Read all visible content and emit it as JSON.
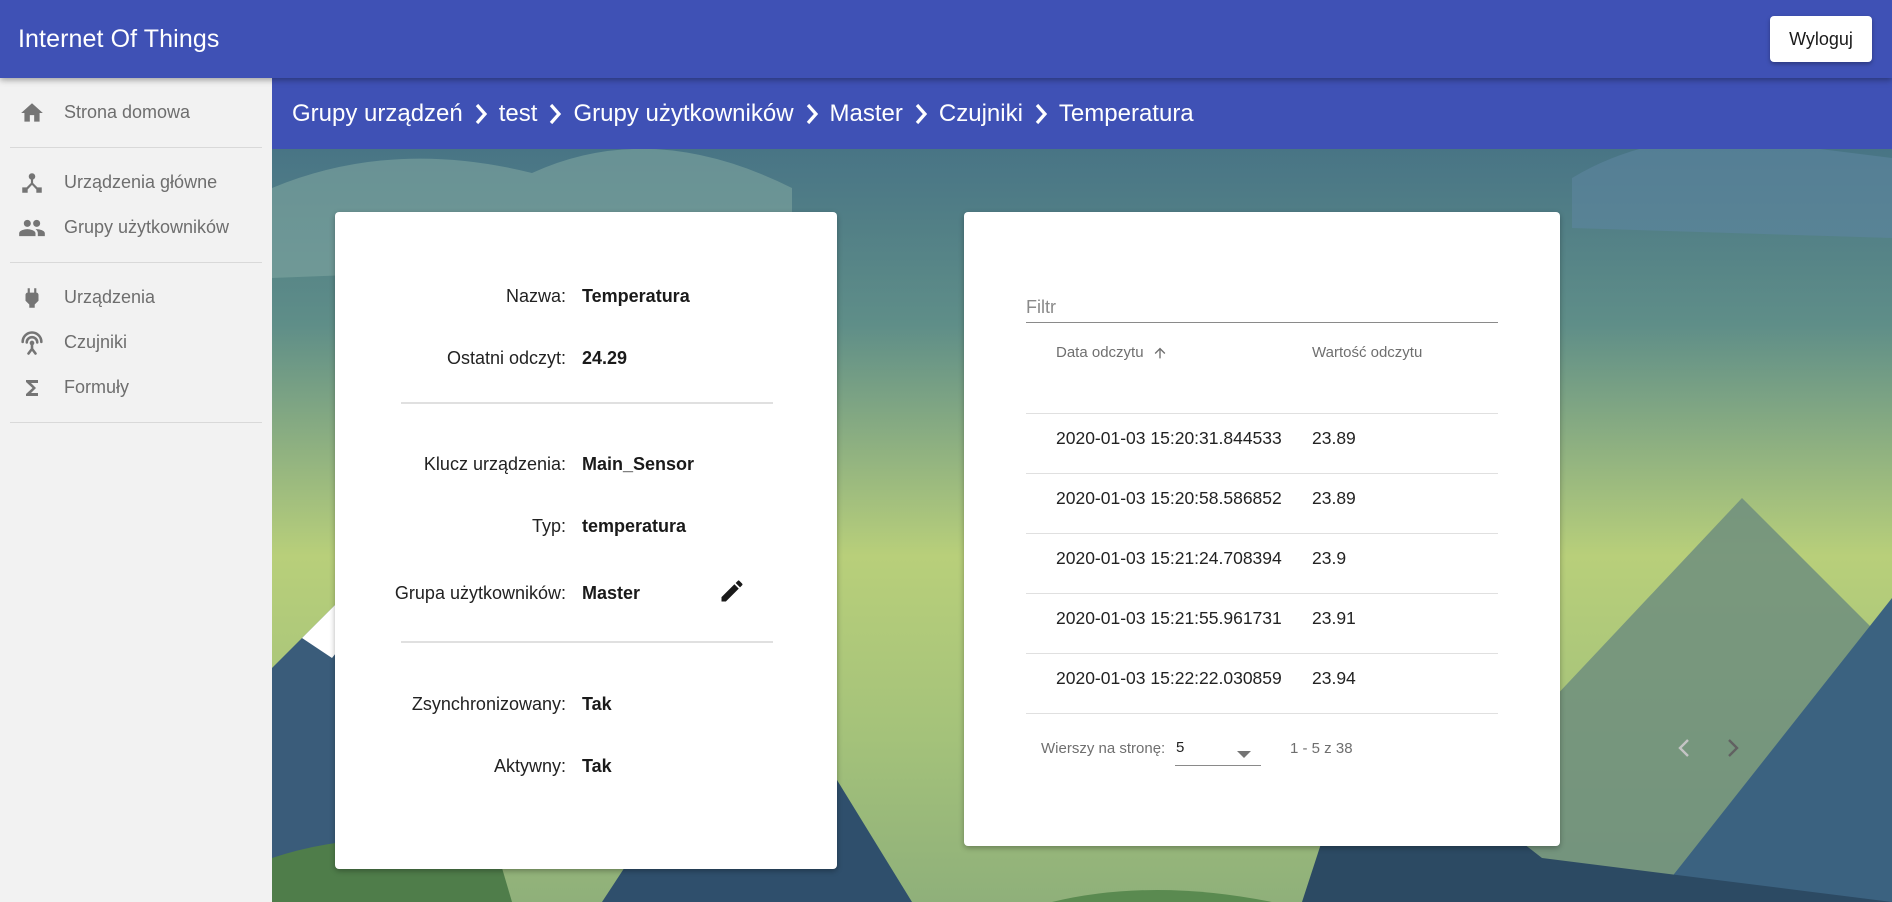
{
  "app": {
    "title": "Internet Of Things",
    "logout_label": "Wyloguj",
    "primary_color": "#3f51b5"
  },
  "sidebar": {
    "groups": [
      [
        {
          "label": "Strona domowa",
          "icon": "home-icon"
        }
      ],
      [
        {
          "label": "Urządzenia główne",
          "icon": "device-hub-icon"
        },
        {
          "label": "Grupy użytkowników",
          "icon": "people-icon"
        }
      ],
      [
        {
          "label": "Urządzenia",
          "icon": "power-plug-icon"
        },
        {
          "label": "Czujniki",
          "icon": "antenna-icon"
        },
        {
          "label": "Formuły",
          "icon": "sigma-icon"
        }
      ]
    ]
  },
  "breadcrumb": [
    "Grupy urządzeń",
    "test",
    "Grupy użytkowników",
    "Master",
    "Czujniki",
    "Temperatura"
  ],
  "details": {
    "name_label": "Nazwa:",
    "name_value": "Temperatura",
    "last_reading_label": "Ostatni odczyt:",
    "last_reading_value": "24.29",
    "device_key_label": "Klucz urządzenia:",
    "device_key_value": "Main_Sensor",
    "type_label": "Typ:",
    "type_value": "temperatura",
    "user_group_label": "Grupa użytkowników:",
    "user_group_value": "Master",
    "synced_label": "Zsynchronizowany:",
    "synced_value": "Tak",
    "active_label": "Aktywny:",
    "active_value": "Tak"
  },
  "readings": {
    "filter_placeholder": "Filtr",
    "filter_value": "",
    "columns": {
      "date": "Data odczytu",
      "value": "Wartość odczytu"
    },
    "sort": {
      "column": "date",
      "direction": "asc"
    },
    "rows": [
      {
        "date": "2020-01-03 15:20:31.844533",
        "value": "23.89"
      },
      {
        "date": "2020-01-03 15:20:58.586852",
        "value": "23.89"
      },
      {
        "date": "2020-01-03 15:21:24.708394",
        "value": "23.9"
      },
      {
        "date": "2020-01-03 15:21:55.961731",
        "value": "23.91"
      },
      {
        "date": "2020-01-03 15:22:22.030859",
        "value": "23.94"
      }
    ],
    "pagination": {
      "rows_per_page_label": "Wierszy na stronę:",
      "rows_per_page": "5",
      "range": "1 - 5 z 38",
      "prev_enabled": false,
      "next_enabled": true
    }
  }
}
